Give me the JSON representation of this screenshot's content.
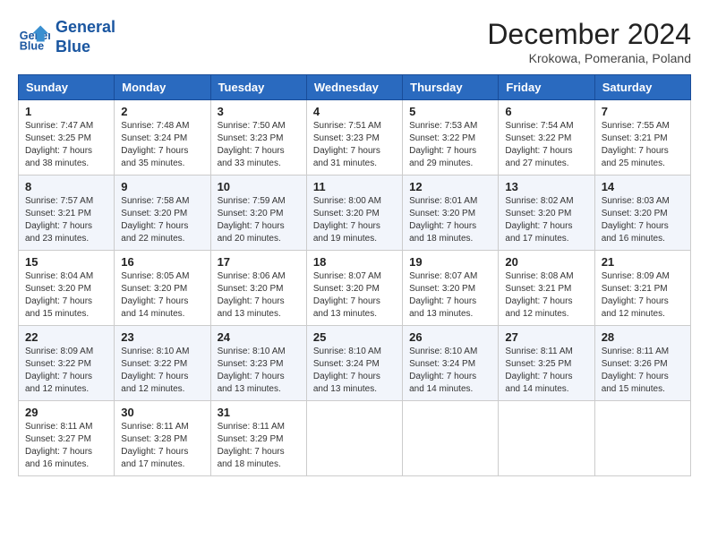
{
  "header": {
    "logo_line1": "General",
    "logo_line2": "Blue",
    "month_title": "December 2024",
    "location": "Krokowa, Pomerania, Poland"
  },
  "weekdays": [
    "Sunday",
    "Monday",
    "Tuesday",
    "Wednesday",
    "Thursday",
    "Friday",
    "Saturday"
  ],
  "weeks": [
    [
      {
        "day": "1",
        "info": "Sunrise: 7:47 AM\nSunset: 3:25 PM\nDaylight: 7 hours\nand 38 minutes."
      },
      {
        "day": "2",
        "info": "Sunrise: 7:48 AM\nSunset: 3:24 PM\nDaylight: 7 hours\nand 35 minutes."
      },
      {
        "day": "3",
        "info": "Sunrise: 7:50 AM\nSunset: 3:23 PM\nDaylight: 7 hours\nand 33 minutes."
      },
      {
        "day": "4",
        "info": "Sunrise: 7:51 AM\nSunset: 3:23 PM\nDaylight: 7 hours\nand 31 minutes."
      },
      {
        "day": "5",
        "info": "Sunrise: 7:53 AM\nSunset: 3:22 PM\nDaylight: 7 hours\nand 29 minutes."
      },
      {
        "day": "6",
        "info": "Sunrise: 7:54 AM\nSunset: 3:22 PM\nDaylight: 7 hours\nand 27 minutes."
      },
      {
        "day": "7",
        "info": "Sunrise: 7:55 AM\nSunset: 3:21 PM\nDaylight: 7 hours\nand 25 minutes."
      }
    ],
    [
      {
        "day": "8",
        "info": "Sunrise: 7:57 AM\nSunset: 3:21 PM\nDaylight: 7 hours\nand 23 minutes."
      },
      {
        "day": "9",
        "info": "Sunrise: 7:58 AM\nSunset: 3:20 PM\nDaylight: 7 hours\nand 22 minutes."
      },
      {
        "day": "10",
        "info": "Sunrise: 7:59 AM\nSunset: 3:20 PM\nDaylight: 7 hours\nand 20 minutes."
      },
      {
        "day": "11",
        "info": "Sunrise: 8:00 AM\nSunset: 3:20 PM\nDaylight: 7 hours\nand 19 minutes."
      },
      {
        "day": "12",
        "info": "Sunrise: 8:01 AM\nSunset: 3:20 PM\nDaylight: 7 hours\nand 18 minutes."
      },
      {
        "day": "13",
        "info": "Sunrise: 8:02 AM\nSunset: 3:20 PM\nDaylight: 7 hours\nand 17 minutes."
      },
      {
        "day": "14",
        "info": "Sunrise: 8:03 AM\nSunset: 3:20 PM\nDaylight: 7 hours\nand 16 minutes."
      }
    ],
    [
      {
        "day": "15",
        "info": "Sunrise: 8:04 AM\nSunset: 3:20 PM\nDaylight: 7 hours\nand 15 minutes."
      },
      {
        "day": "16",
        "info": "Sunrise: 8:05 AM\nSunset: 3:20 PM\nDaylight: 7 hours\nand 14 minutes."
      },
      {
        "day": "17",
        "info": "Sunrise: 8:06 AM\nSunset: 3:20 PM\nDaylight: 7 hours\nand 13 minutes."
      },
      {
        "day": "18",
        "info": "Sunrise: 8:07 AM\nSunset: 3:20 PM\nDaylight: 7 hours\nand 13 minutes."
      },
      {
        "day": "19",
        "info": "Sunrise: 8:07 AM\nSunset: 3:20 PM\nDaylight: 7 hours\nand 13 minutes."
      },
      {
        "day": "20",
        "info": "Sunrise: 8:08 AM\nSunset: 3:21 PM\nDaylight: 7 hours\nand 12 minutes."
      },
      {
        "day": "21",
        "info": "Sunrise: 8:09 AM\nSunset: 3:21 PM\nDaylight: 7 hours\nand 12 minutes."
      }
    ],
    [
      {
        "day": "22",
        "info": "Sunrise: 8:09 AM\nSunset: 3:22 PM\nDaylight: 7 hours\nand 12 minutes."
      },
      {
        "day": "23",
        "info": "Sunrise: 8:10 AM\nSunset: 3:22 PM\nDaylight: 7 hours\nand 12 minutes."
      },
      {
        "day": "24",
        "info": "Sunrise: 8:10 AM\nSunset: 3:23 PM\nDaylight: 7 hours\nand 13 minutes."
      },
      {
        "day": "25",
        "info": "Sunrise: 8:10 AM\nSunset: 3:24 PM\nDaylight: 7 hours\nand 13 minutes."
      },
      {
        "day": "26",
        "info": "Sunrise: 8:10 AM\nSunset: 3:24 PM\nDaylight: 7 hours\nand 14 minutes."
      },
      {
        "day": "27",
        "info": "Sunrise: 8:11 AM\nSunset: 3:25 PM\nDaylight: 7 hours\nand 14 minutes."
      },
      {
        "day": "28",
        "info": "Sunrise: 8:11 AM\nSunset: 3:26 PM\nDaylight: 7 hours\nand 15 minutes."
      }
    ],
    [
      {
        "day": "29",
        "info": "Sunrise: 8:11 AM\nSunset: 3:27 PM\nDaylight: 7 hours\nand 16 minutes."
      },
      {
        "day": "30",
        "info": "Sunrise: 8:11 AM\nSunset: 3:28 PM\nDaylight: 7 hours\nand 17 minutes."
      },
      {
        "day": "31",
        "info": "Sunrise: 8:11 AM\nSunset: 3:29 PM\nDaylight: 7 hours\nand 18 minutes."
      },
      null,
      null,
      null,
      null
    ]
  ]
}
